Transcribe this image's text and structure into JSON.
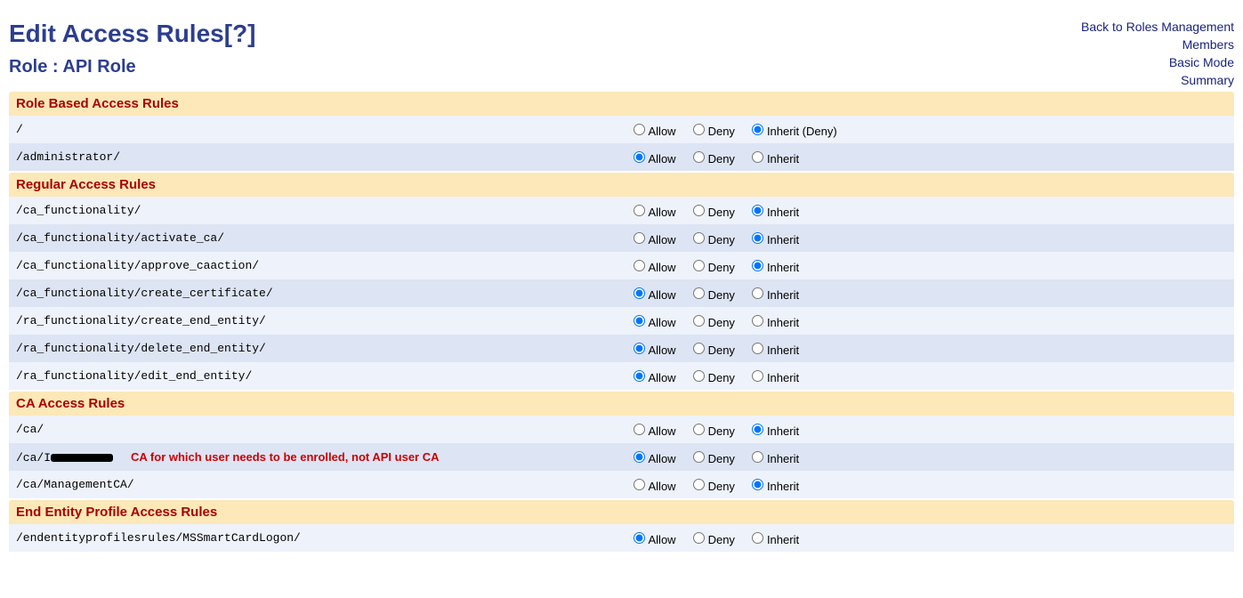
{
  "header": {
    "title": "Edit Access Rules",
    "help_left": "[",
    "help_mark": "?",
    "help_right": "]",
    "role_label": "Role :",
    "role_name": "API Role"
  },
  "nav": {
    "back": "Back to Roles Management",
    "members": "Members",
    "basic": "Basic Mode",
    "summary": "Summary"
  },
  "labels": {
    "allow": "Allow",
    "deny": "Deny",
    "inherit": "Inherit",
    "inherit_deny": "Inherit (Deny)"
  },
  "sections": [
    {
      "title": "Role Based Access Rules",
      "rows": [
        {
          "path": "/",
          "selected": "inherit",
          "inherit_label": "inherit_deny"
        },
        {
          "path": "/administrator/",
          "selected": "allow",
          "inherit_label": "inherit"
        }
      ]
    },
    {
      "title": "Regular Access Rules",
      "rows": [
        {
          "path": "/ca_functionality/",
          "selected": "inherit",
          "inherit_label": "inherit"
        },
        {
          "path": "/ca_functionality/activate_ca/",
          "selected": "inherit",
          "inherit_label": "inherit"
        },
        {
          "path": "/ca_functionality/approve_caaction/",
          "selected": "inherit",
          "inherit_label": "inherit"
        },
        {
          "path": "/ca_functionality/create_certificate/",
          "selected": "allow",
          "inherit_label": "inherit"
        },
        {
          "path": "/ra_functionality/create_end_entity/",
          "selected": "allow",
          "inherit_label": "inherit"
        },
        {
          "path": "/ra_functionality/delete_end_entity/",
          "selected": "allow",
          "inherit_label": "inherit"
        },
        {
          "path": "/ra_functionality/edit_end_entity/",
          "selected": "allow",
          "inherit_label": "inherit"
        }
      ]
    },
    {
      "title": "CA Access Rules",
      "rows": [
        {
          "path": "/ca/",
          "selected": "inherit",
          "inherit_label": "inherit"
        },
        {
          "path": "/ca/I",
          "redacted": true,
          "annotation": "CA for which user needs to be enrolled, not API user CA",
          "selected": "allow",
          "inherit_label": "inherit"
        },
        {
          "path": "/ca/ManagementCA/",
          "selected": "inherit",
          "inherit_label": "inherit"
        }
      ]
    },
    {
      "title": "End Entity Profile Access Rules",
      "rows": [
        {
          "path": "/endentityprofilesrules/MSSmartCardLogon/",
          "selected": "allow",
          "inherit_label": "inherit"
        }
      ]
    }
  ]
}
